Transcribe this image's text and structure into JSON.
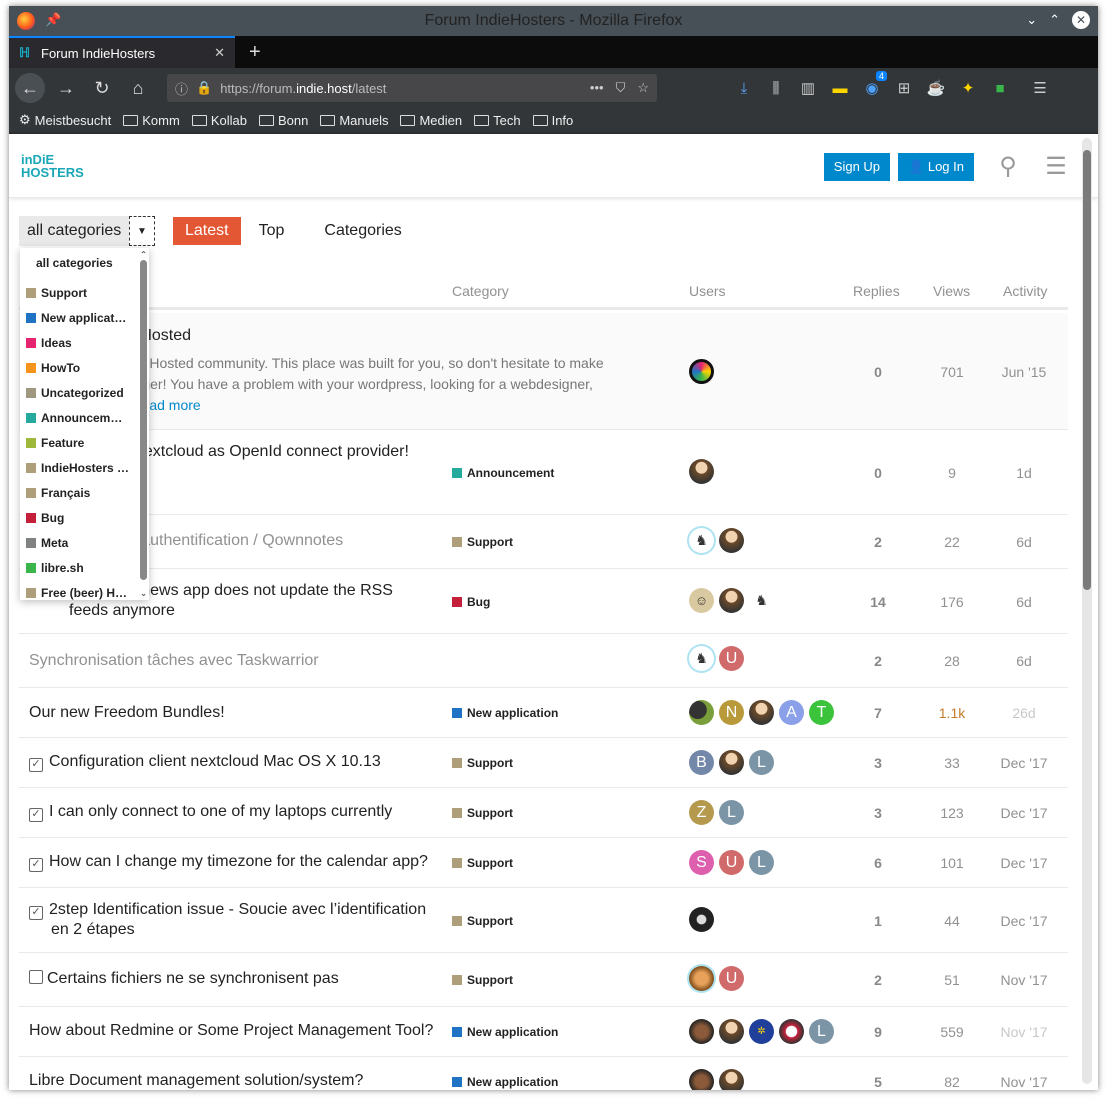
{
  "window": {
    "title": "Forum IndieHosters - Mozilla Firefox",
    "tab_title": "Forum IndieHosters",
    "url_prefix": "https://forum.",
    "url_domain": "indie.host",
    "url_path": "/latest"
  },
  "bookmarks": [
    "Meistbesucht",
    "Komm",
    "Kollab",
    "Bonn",
    "Manuels",
    "Medien",
    "Tech",
    "Info"
  ],
  "toolbar_badge": "4",
  "site": {
    "logo_line1": "inDiE",
    "logo_line2": "HOSTERS",
    "signup": "Sign Up",
    "login": "Log In"
  },
  "nav": {
    "category_select": "all categories",
    "tabs": [
      "Latest",
      "Top",
      "Categories"
    ]
  },
  "dropdown": {
    "header": "all categories",
    "items": [
      {
        "label": "Support",
        "color": "#ae9e7a"
      },
      {
        "label": "New applicat…",
        "color": "#1f72c4"
      },
      {
        "label": "Ideas",
        "color": "#e6236e"
      },
      {
        "label": "HowTo",
        "color": "#f7941d"
      },
      {
        "label": "Uncategorized",
        "color": "#a09780"
      },
      {
        "label": "Announcem…",
        "color": "#25aa9d"
      },
      {
        "label": "Feature",
        "color": "#9eb83b"
      },
      {
        "label": "IndieHosters …",
        "color": "#ae9e7a"
      },
      {
        "label": "Français",
        "color": "#ae9e7a"
      },
      {
        "label": "Bug",
        "color": "#c5203b"
      },
      {
        "label": "Meta",
        "color": "#808281"
      },
      {
        "label": "libre.sh",
        "color": "#3ab54a"
      },
      {
        "label": "Free (beer) H…",
        "color": "#ae9e7a"
      }
    ]
  },
  "columns": {
    "category": "Category",
    "users": "Users",
    "replies": "Replies",
    "views": "Views",
    "activity": "Activity"
  },
  "topics": [
    {
      "title": "dieHosted",
      "excerpt1": "IndieHosted community. This place was built for you, so don't hesitate to make",
      "excerpt2": "h other! You have a problem with your wordpress, looking for a webdesigner,",
      "excerpt3": "…",
      "read_more": "read more",
      "category": "",
      "replies": "0",
      "views": "701",
      "activity": "Jun '15"
    },
    {
      "title": "d Nextcloud as OpenId connect provider!",
      "category": "Announcement",
      "replies": "0",
      "views": "9",
      "activity": "1d"
    },
    {
      "title": "r d’authentification / Qownnotes",
      "category": "Support",
      "replies": "2",
      "views": "22",
      "activity": "6d"
    },
    {
      "title": "he news app does not update the RSS",
      "title2": "feeds anymore",
      "category": "Bug",
      "replies": "14",
      "views": "176",
      "activity": "6d"
    },
    {
      "title": "Synchronisation tâches avec Taskwarrior",
      "category": "",
      "replies": "2",
      "views": "28",
      "activity": "6d"
    },
    {
      "title": "Our new Freedom Bundles!",
      "category": "New application",
      "replies": "7",
      "views": "1.1k",
      "activity": "26d"
    },
    {
      "title": "Configuration client nextcloud Mac OS X 10.13",
      "category": "Support",
      "replies": "3",
      "views": "33",
      "activity": "Dec '17"
    },
    {
      "title": "I can only connect to one of my laptops currently",
      "category": "Support",
      "replies": "3",
      "views": "123",
      "activity": "Dec '17"
    },
    {
      "title": "How can I change my timezone for the calendar app?",
      "category": "Support",
      "replies": "6",
      "views": "101",
      "activity": "Dec '17"
    },
    {
      "title": "2step Identification issue - Soucie avec l’identification",
      "title2": "en 2 étapes",
      "category": "Support",
      "replies": "1",
      "views": "44",
      "activity": "Dec '17"
    },
    {
      "title": "Certains fichiers ne se synchronisent pas",
      "category": "Support",
      "replies": "2",
      "views": "51",
      "activity": "Nov '17"
    },
    {
      "title": "How about Redmine or Some Project Management Tool?",
      "category": "New application",
      "replies": "9",
      "views": "559",
      "activity": "Nov '17"
    },
    {
      "title": "Libre Document management solution/system?",
      "category": "New application",
      "replies": "5",
      "views": "82",
      "activity": "Nov '17"
    }
  ],
  "avatar_letters": {
    "U": "U",
    "N": "N",
    "A": "A",
    "T": "T",
    "B": "B",
    "L": "L",
    "Z": "Z",
    "S": "S"
  },
  "colors": {
    "accent": "#e45735",
    "link": "#0088cc",
    "support": "#ae9e7a",
    "new_application": "#1f72c4",
    "announcement": "#25aa9d",
    "bug": "#c5203b"
  }
}
